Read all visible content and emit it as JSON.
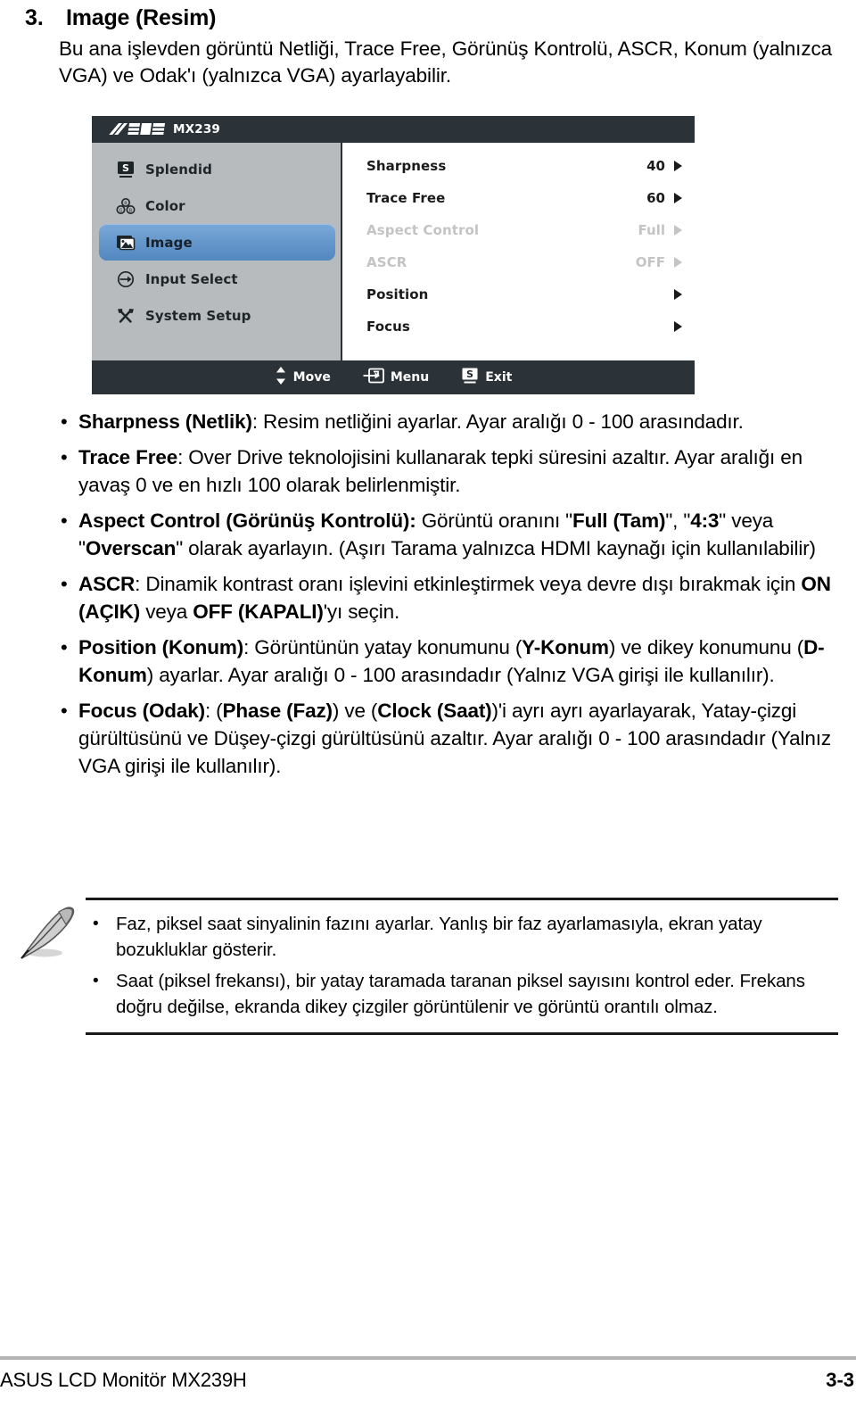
{
  "section": {
    "number": "3.",
    "title": "Image (Resim)",
    "intro": "Bu ana işlevden görüntü Netliği, Trace Free, Görünüş Kontrolü, ASCR, Konum (yalnızca VGA) ve Odak'ı (yalnızca VGA) ayarlayabilir."
  },
  "osd": {
    "logo": "ASUS",
    "model": "MX239",
    "sidebar": [
      {
        "label": "Splendid",
        "icon": "splendid-icon",
        "active": false
      },
      {
        "label": "Color",
        "icon": "color-icon",
        "active": false
      },
      {
        "label": "Image",
        "icon": "image-icon",
        "active": true
      },
      {
        "label": "Input Select",
        "icon": "input-select-icon",
        "active": false
      },
      {
        "label": "System Setup",
        "icon": "system-setup-icon",
        "active": false
      }
    ],
    "options": [
      {
        "label": "Sharpness",
        "value": "40",
        "disabled": false
      },
      {
        "label": "Trace Free",
        "value": "60",
        "disabled": false
      },
      {
        "label": "Aspect Control",
        "value": "Full",
        "disabled": true
      },
      {
        "label": "ASCR",
        "value": "OFF",
        "disabled": true
      },
      {
        "label": "Position",
        "value": "",
        "disabled": false
      },
      {
        "label": "Focus",
        "value": "",
        "disabled": false
      }
    ],
    "footer": [
      {
        "label": "Move",
        "icon": "up-down-arrows-icon"
      },
      {
        "label": "Menu",
        "icon": "menu-enter-icon"
      },
      {
        "label": "Exit",
        "icon": "splendid-s-icon"
      }
    ],
    "colors": {
      "chrome": "#2b3338",
      "sidebar": "#b7bbbd",
      "highlight": "#5287bf",
      "content": "#ffffff",
      "disabled_text": "#c4c4c4"
    }
  },
  "bullets": [
    {
      "bullet": "•",
      "parts": [
        {
          "t": "Sharpness (Netlik)",
          "b": true
        },
        {
          "t": ": Resim netliğini ayarlar. Ayar aralığı 0 - 100 arasındadır.",
          "b": false
        }
      ]
    },
    {
      "bullet": "•",
      "parts": [
        {
          "t": "Trace Free",
          "b": true
        },
        {
          "t": ": Over Drive teknolojisini kullanarak tepki süresini azaltır. Ayar aralığı en yavaş 0 ve en hızlı 100 olarak belirlenmiştir.",
          "b": false
        }
      ]
    },
    {
      "bullet": "•",
      "parts": [
        {
          "t": "Aspect Control (Görünüş Kontrolü):",
          "b": true
        },
        {
          "t": " Görüntü oranını \"",
          "b": false
        },
        {
          "t": "Full (Tam)",
          "b": true
        },
        {
          "t": "\", \"",
          "b": false
        },
        {
          "t": "4:3",
          "b": true
        },
        {
          "t": "\" veya \"",
          "b": false
        },
        {
          "t": "Overscan",
          "b": true
        },
        {
          "t": "\" olarak ayarlayın. (Aşırı Tarama yalnızca HDMI kaynağı için kullanılabilir)",
          "b": false
        }
      ]
    },
    {
      "bullet": "•",
      "parts": [
        {
          "t": "ASCR",
          "b": true
        },
        {
          "t": ": Dinamik kontrast oranı işlevini etkinleştirmek veya devre dışı bırakmak için ",
          "b": false
        },
        {
          "t": "ON (AÇIK)",
          "b": true
        },
        {
          "t": " veya ",
          "b": false
        },
        {
          "t": "OFF (KAPALI)",
          "b": true
        },
        {
          "t": "'yı seçin.",
          "b": false
        }
      ]
    },
    {
      "bullet": "•",
      "parts": [
        {
          "t": "Position (Konum)",
          "b": true
        },
        {
          "t": ": Görüntünün yatay konumunu (",
          "b": false
        },
        {
          "t": "Y-Konum",
          "b": true
        },
        {
          "t": ") ve dikey konumunu (",
          "b": false
        },
        {
          "t": "D-Konum",
          "b": true
        },
        {
          "t": ") ayarlar. Ayar aralığı 0 - 100 arasındadır (Yalnız VGA girişi ile kullanılır).",
          "b": false
        }
      ]
    },
    {
      "bullet": "•",
      "parts": [
        {
          "t": "Focus (Odak)",
          "b": true
        },
        {
          "t": ": (",
          "b": false
        },
        {
          "t": "Phase (Faz)",
          "b": true
        },
        {
          "t": ") ve (",
          "b": false
        },
        {
          "t": "Clock (Saat)",
          "b": true
        },
        {
          "t": ")'i ayrı ayrı ayarlayarak, Yatay-çizgi gürültüsünü ve Düşey-çizgi gürültüsünü azaltır. Ayar aralığı 0 - 100 arasındadır (Yalnız VGA girişi ile kullanılır).",
          "b": false
        }
      ]
    }
  ],
  "note": {
    "icon": "quill-pen-icon",
    "items": [
      {
        "bullet": "•",
        "text": "Faz, piksel saat sinyalinin fazını ayarlar. Yanlış bir faz ayarlamasıyla, ekran yatay bozukluklar gösterir."
      },
      {
        "bullet": "•",
        "text": "Saat (piksel frekansı), bir yatay taramada taranan piksel sayısını kontrol eder. Frekans doğru değilse, ekranda dikey çizgiler görüntülenir ve görüntü orantılı olmaz."
      }
    ]
  },
  "page_footer": {
    "left": "ASUS LCD Monitör MX239H",
    "right": "3-3"
  }
}
